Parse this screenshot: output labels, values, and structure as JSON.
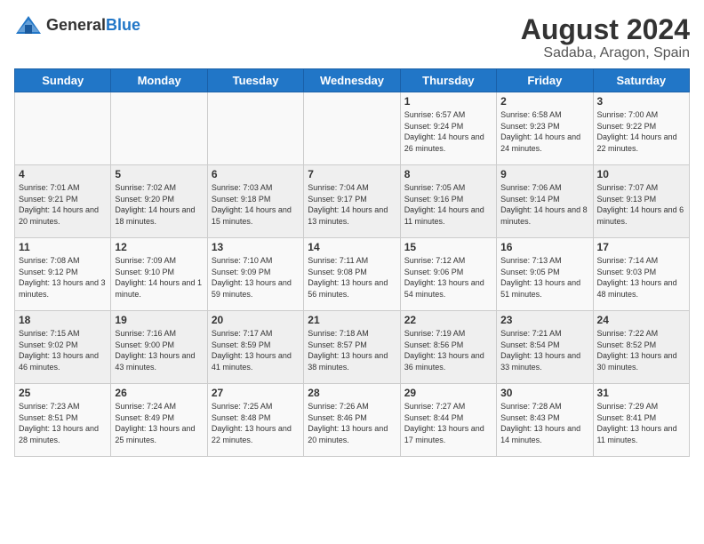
{
  "header": {
    "logo": {
      "general": "General",
      "blue": "Blue"
    },
    "title": "August 2024",
    "subtitle": "Sadaba, Aragon, Spain"
  },
  "weekdays": [
    "Sunday",
    "Monday",
    "Tuesday",
    "Wednesday",
    "Thursday",
    "Friday",
    "Saturday"
  ],
  "weeks": [
    [
      {
        "day": "",
        "info": ""
      },
      {
        "day": "",
        "info": ""
      },
      {
        "day": "",
        "info": ""
      },
      {
        "day": "",
        "info": ""
      },
      {
        "day": "1",
        "sunrise": "6:57 AM",
        "sunset": "9:24 PM",
        "daylight": "14 hours and 26 minutes."
      },
      {
        "day": "2",
        "sunrise": "6:58 AM",
        "sunset": "9:23 PM",
        "daylight": "14 hours and 24 minutes."
      },
      {
        "day": "3",
        "sunrise": "7:00 AM",
        "sunset": "9:22 PM",
        "daylight": "14 hours and 22 minutes."
      }
    ],
    [
      {
        "day": "4",
        "sunrise": "7:01 AM",
        "sunset": "9:21 PM",
        "daylight": "14 hours and 20 minutes."
      },
      {
        "day": "5",
        "sunrise": "7:02 AM",
        "sunset": "9:20 PM",
        "daylight": "14 hours and 18 minutes."
      },
      {
        "day": "6",
        "sunrise": "7:03 AM",
        "sunset": "9:18 PM",
        "daylight": "14 hours and 15 minutes."
      },
      {
        "day": "7",
        "sunrise": "7:04 AM",
        "sunset": "9:17 PM",
        "daylight": "14 hours and 13 minutes."
      },
      {
        "day": "8",
        "sunrise": "7:05 AM",
        "sunset": "9:16 PM",
        "daylight": "14 hours and 11 minutes."
      },
      {
        "day": "9",
        "sunrise": "7:06 AM",
        "sunset": "9:14 PM",
        "daylight": "14 hours and 8 minutes."
      },
      {
        "day": "10",
        "sunrise": "7:07 AM",
        "sunset": "9:13 PM",
        "daylight": "14 hours and 6 minutes."
      }
    ],
    [
      {
        "day": "11",
        "sunrise": "7:08 AM",
        "sunset": "9:12 PM",
        "daylight": "13 hours and 3 minutes."
      },
      {
        "day": "12",
        "sunrise": "7:09 AM",
        "sunset": "9:10 PM",
        "daylight": "14 hours and 1 minute."
      },
      {
        "day": "13",
        "sunrise": "7:10 AM",
        "sunset": "9:09 PM",
        "daylight": "13 hours and 59 minutes."
      },
      {
        "day": "14",
        "sunrise": "7:11 AM",
        "sunset": "9:08 PM",
        "daylight": "13 hours and 56 minutes."
      },
      {
        "day": "15",
        "sunrise": "7:12 AM",
        "sunset": "9:06 PM",
        "daylight": "13 hours and 54 minutes."
      },
      {
        "day": "16",
        "sunrise": "7:13 AM",
        "sunset": "9:05 PM",
        "daylight": "13 hours and 51 minutes."
      },
      {
        "day": "17",
        "sunrise": "7:14 AM",
        "sunset": "9:03 PM",
        "daylight": "13 hours and 48 minutes."
      }
    ],
    [
      {
        "day": "18",
        "sunrise": "7:15 AM",
        "sunset": "9:02 PM",
        "daylight": "13 hours and 46 minutes."
      },
      {
        "day": "19",
        "sunrise": "7:16 AM",
        "sunset": "9:00 PM",
        "daylight": "13 hours and 43 minutes."
      },
      {
        "day": "20",
        "sunrise": "7:17 AM",
        "sunset": "8:59 PM",
        "daylight": "13 hours and 41 minutes."
      },
      {
        "day": "21",
        "sunrise": "7:18 AM",
        "sunset": "8:57 PM",
        "daylight": "13 hours and 38 minutes."
      },
      {
        "day": "22",
        "sunrise": "7:19 AM",
        "sunset": "8:56 PM",
        "daylight": "13 hours and 36 minutes."
      },
      {
        "day": "23",
        "sunrise": "7:21 AM",
        "sunset": "8:54 PM",
        "daylight": "13 hours and 33 minutes."
      },
      {
        "day": "24",
        "sunrise": "7:22 AM",
        "sunset": "8:52 PM",
        "daylight": "13 hours and 30 minutes."
      }
    ],
    [
      {
        "day": "25",
        "sunrise": "7:23 AM",
        "sunset": "8:51 PM",
        "daylight": "13 hours and 28 minutes."
      },
      {
        "day": "26",
        "sunrise": "7:24 AM",
        "sunset": "8:49 PM",
        "daylight": "13 hours and 25 minutes."
      },
      {
        "day": "27",
        "sunrise": "7:25 AM",
        "sunset": "8:48 PM",
        "daylight": "13 hours and 22 minutes."
      },
      {
        "day": "28",
        "sunrise": "7:26 AM",
        "sunset": "8:46 PM",
        "daylight": "13 hours and 20 minutes."
      },
      {
        "day": "29",
        "sunrise": "7:27 AM",
        "sunset": "8:44 PM",
        "daylight": "13 hours and 17 minutes."
      },
      {
        "day": "30",
        "sunrise": "7:28 AM",
        "sunset": "8:43 PM",
        "daylight": "13 hours and 14 minutes."
      },
      {
        "day": "31",
        "sunrise": "7:29 AM",
        "sunset": "8:41 PM",
        "daylight": "13 hours and 11 minutes."
      }
    ]
  ]
}
